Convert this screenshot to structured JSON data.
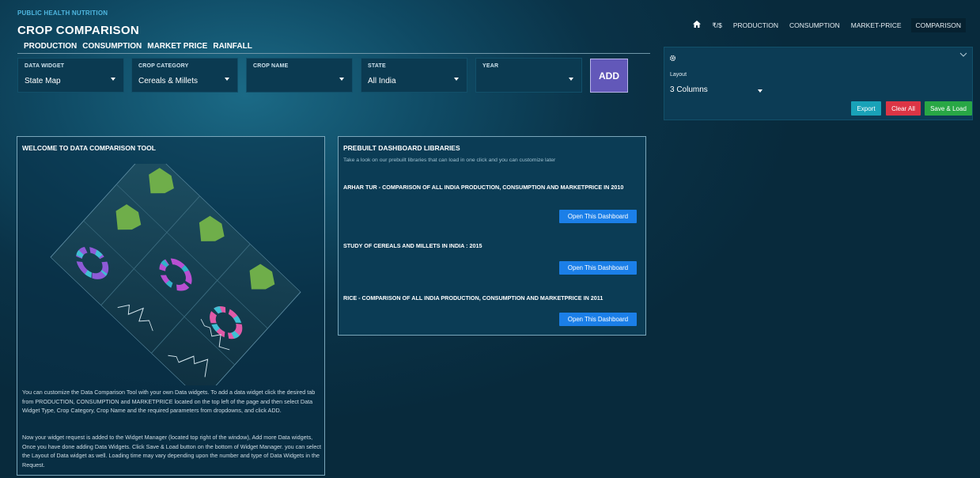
{
  "brand": {
    "subtitle": "PUBLIC HEALTH NUTRITION",
    "title": "CROP COMPARISON"
  },
  "subnav": [
    "PRODUCTION",
    "CONSUMPTION",
    "MARKET PRICE",
    "RAINFALL"
  ],
  "topnav": {
    "home_icon": "home-icon",
    "currency": "₹/$",
    "items": [
      "PRODUCTION",
      "CONSUMPTION",
      "MARKET-PRICE",
      "COMPARISON"
    ],
    "active": "COMPARISON"
  },
  "filters": [
    {
      "label": "DATA WIDGET",
      "value": "State Map"
    },
    {
      "label": "CROP CATEGORY",
      "value": "Cereals & Millets"
    },
    {
      "label": "CROP NAME",
      "value": ""
    },
    {
      "label": "STATE",
      "value": "All India"
    },
    {
      "label": "YEAR",
      "value": ""
    }
  ],
  "add_label": "ADD",
  "manager": {
    "gear_icon": "gear-icon",
    "chevron_icon": "chevron-down-icon",
    "layout_label": "Layout",
    "layout_value": "3 Columns",
    "export_label": "Export",
    "clear_label": "Clear All",
    "save_label": "Save & Load",
    "colors": {
      "export": "#19a2b8",
      "clear": "#dc3545",
      "save": "#28a745"
    }
  },
  "welcome": {
    "title": "WELCOME TO DATA COMPARISON TOOL",
    "para1": "You can customize the Data Comparison Tool with your own Data widgets. To add a data widget click the desired tab from PRODUCTION, CONSUMPTION and MARKETPRICE located on the top left of the page and then select Data Widget Type, Crop Category, Crop Name and the required parameters from dropdowns, and click ADD.",
    "para2": "Now your widget request is added to the Widget Manager (located top right of the window), Add more Data widgets, Once you have done adding Data Widgets. Click Save & Load button on the bottom of Widget Manager. you can select the Layout of Data widget as well. Loading time may vary depending upon the number and type of Data Widgets in the Request."
  },
  "prebuilt": {
    "title": "PREBUILT DASHBOARD LIBRARIES",
    "description": "Take a look on our prebuilt libraries that can load in one click and you can customize later",
    "dashboards": [
      {
        "title": "ARHAR TUR - COMPARISON OF ALL INDIA PRODUCTION, CONSUMPTION AND MARKETPRICE IN 2010",
        "button": "Open This Dashboard"
      },
      {
        "title": "STUDY OF CEREALS AND MILLETS IN INDIA : 2015",
        "button": "Open This Dashboard"
      },
      {
        "title": "RICE - COMPARISON OF ALL INDIA PRODUCTION, CONSUMPTION AND MARKETPRICE IN 2011",
        "button": "Open This Dashboard"
      }
    ]
  },
  "colors": {
    "accent_blue": "#1b7fe8",
    "add_button": "#6258b9",
    "brand_sub": "#4fb7e0"
  }
}
